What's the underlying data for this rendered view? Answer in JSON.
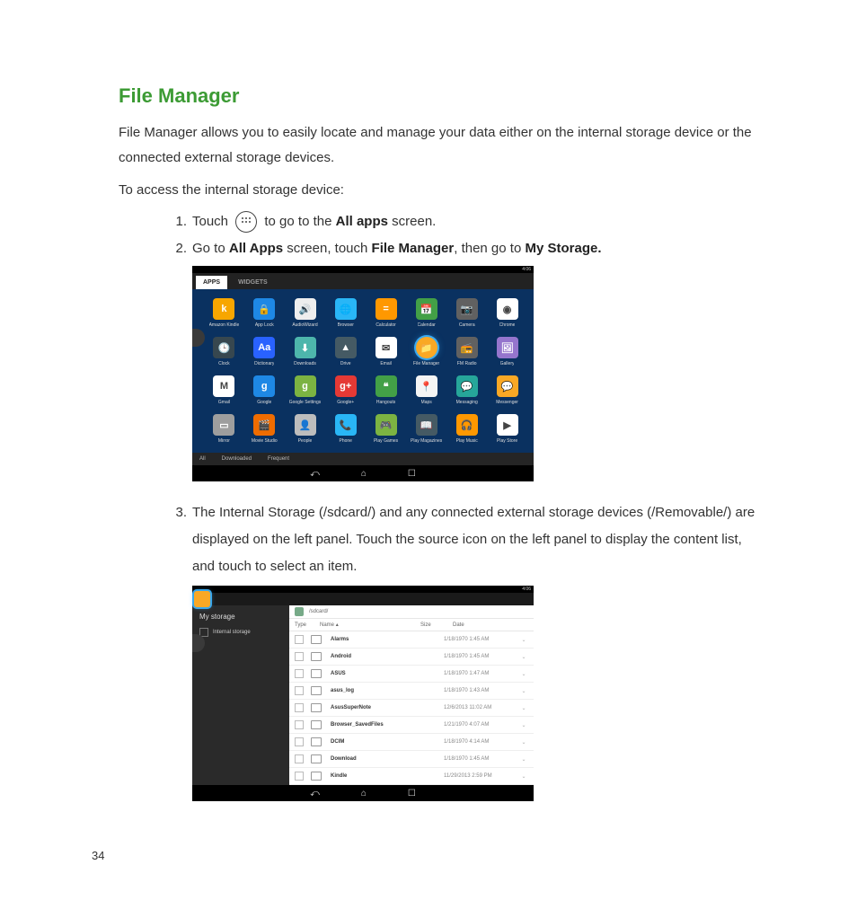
{
  "page_number": "34",
  "title": "File Manager",
  "intro": "File Manager allows you to easily locate and manage your data either on the internal storage device or the connected external storage devices.",
  "subhead": "To access the internal storage device:",
  "step1_pre": "Touch ",
  "step1_post": " to go to the ",
  "step1_bold": "All apps",
  "step1_tail": " screen.",
  "step2_a": "Go to ",
  "step2_b": "All Apps",
  "step2_c": " screen, touch ",
  "step2_d": "File Manager",
  "step2_e": ", then go to ",
  "step2_f": "My Storage.",
  "step3": "The Internal Storage (/sdcard/) and any connected external storage devices (/Removable/) are displayed on the left panel. Touch the source icon on the left panel to display the content list, and touch to select an item.",
  "status_time": "4:06",
  "apps_tab1": "APPS",
  "apps_tab2": "WIDGETS",
  "apps_filter_all": "All",
  "apps_filter_dl": "Downloaded",
  "apps_filter_fq": "Frequent",
  "apps": [
    {
      "name": "Amazon Kindle",
      "bg": "#f7a600",
      "txt": "k"
    },
    {
      "name": "App Lock",
      "bg": "#1e88e5",
      "txt": "🔒"
    },
    {
      "name": "AudioWizard",
      "bg": "#eee",
      "txt": "🔊"
    },
    {
      "name": "Browser",
      "bg": "#29b6f6",
      "txt": "🌐"
    },
    {
      "name": "Calculator",
      "bg": "#ff9800",
      "txt": "="
    },
    {
      "name": "Calendar",
      "bg": "#43a047",
      "txt": "📅"
    },
    {
      "name": "Camera",
      "bg": "#616161",
      "txt": "📷"
    },
    {
      "name": "Chrome",
      "bg": "#fff",
      "txt": "◉"
    },
    {
      "name": "Clock",
      "bg": "#37474f",
      "txt": "🕒"
    },
    {
      "name": "Dictionary",
      "bg": "#2962ff",
      "txt": "Aa"
    },
    {
      "name": "Downloads",
      "bg": "#4db6ac",
      "txt": "⬇"
    },
    {
      "name": "Drive",
      "bg": "#455a64",
      "txt": "▲"
    },
    {
      "name": "Email",
      "bg": "#fff",
      "txt": "✉"
    },
    {
      "name": "File Manager",
      "bg": "#f9a825",
      "txt": "📁",
      "hl": true
    },
    {
      "name": "FM Radio",
      "bg": "#616161",
      "txt": "📻"
    },
    {
      "name": "Gallery",
      "bg": "#9575cd",
      "txt": "🖼"
    },
    {
      "name": "Gmail",
      "bg": "#fff",
      "txt": "M"
    },
    {
      "name": "Google",
      "bg": "#1e88e5",
      "txt": "g"
    },
    {
      "name": "Google Settings",
      "bg": "#7cb342",
      "txt": "g"
    },
    {
      "name": "Google+",
      "bg": "#e53935",
      "txt": "g+"
    },
    {
      "name": "Hangouts",
      "bg": "#43a047",
      "txt": "❝"
    },
    {
      "name": "Maps",
      "bg": "#f5f5f5",
      "txt": "📍"
    },
    {
      "name": "Messaging",
      "bg": "#26a69a",
      "txt": "💬"
    },
    {
      "name": "Messenger",
      "bg": "#f9a825",
      "txt": "💬"
    },
    {
      "name": "Mirror",
      "bg": "#9e9e9e",
      "txt": "▭"
    },
    {
      "name": "Movie Studio",
      "bg": "#ef6c00",
      "txt": "🎬"
    },
    {
      "name": "People",
      "bg": "#bdbdbd",
      "txt": "👤"
    },
    {
      "name": "Phone",
      "bg": "#29b6f6",
      "txt": "📞"
    },
    {
      "name": "Play Games",
      "bg": "#7cb342",
      "txt": "🎮"
    },
    {
      "name": "Play Magazines",
      "bg": "#455a64",
      "txt": "📖"
    },
    {
      "name": "Play Music",
      "bg": "#ff9800",
      "txt": "🎧"
    },
    {
      "name": "Play Store",
      "bg": "#fff",
      "txt": "▶"
    }
  ],
  "fm_left_title": "My storage",
  "fm_left_item": "Internal storage",
  "fm_crumb": "/sdcard/",
  "fm_col_type": "Type",
  "fm_col_name": "Name",
  "fm_col_size": "Size",
  "fm_col_date": "Date",
  "files": [
    {
      "name": "Alarms",
      "date": "1/18/1970 1:45 AM"
    },
    {
      "name": "Android",
      "date": "1/18/1970 1:45 AM"
    },
    {
      "name": "ASUS",
      "date": "1/18/1970 1:47 AM"
    },
    {
      "name": "asus_log",
      "date": "1/18/1970 1:43 AM"
    },
    {
      "name": "AsusSuperNote",
      "date": "12/6/2013 11:02 AM"
    },
    {
      "name": "Browser_SavedFiles",
      "date": "1/21/1970 4:07 AM"
    },
    {
      "name": "DCIM",
      "date": "1/18/1970 4:14 AM"
    },
    {
      "name": "Download",
      "date": "1/18/1970 1:45 AM"
    },
    {
      "name": "Kindle",
      "date": "11/29/2013 2:59 PM"
    }
  ]
}
